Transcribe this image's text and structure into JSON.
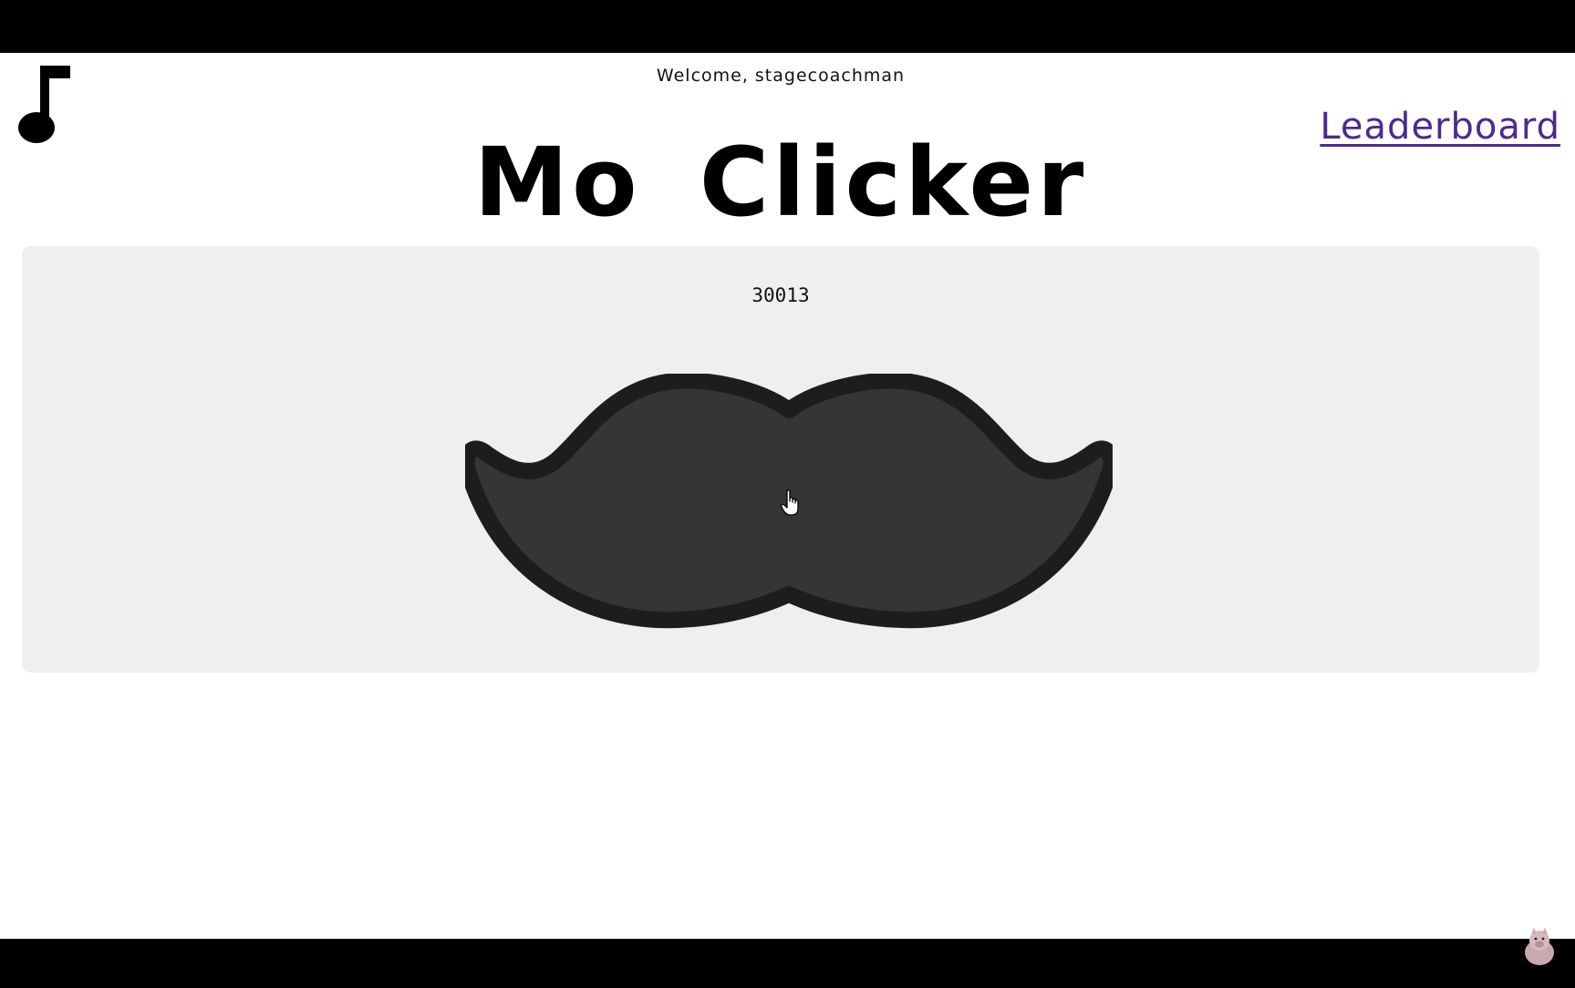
{
  "header": {
    "welcome_text": "Welcome, stagecoachman",
    "leaderboard_label": "Leaderboard",
    "music_icon": "music-note-icon"
  },
  "main": {
    "title": "Mo Clicker",
    "click_count": "30013",
    "clicker_icon": "mustache-icon"
  },
  "colors": {
    "mustache_fill": "#363536",
    "mustache_outline": "#1f1c1f",
    "panel_bg": "#efefef",
    "link": "#4b2a8c"
  }
}
